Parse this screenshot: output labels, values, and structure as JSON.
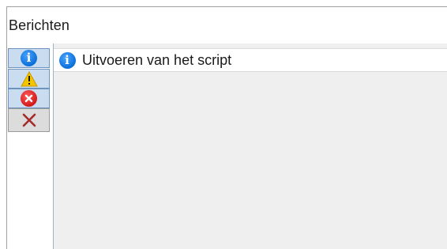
{
  "panel": {
    "title": "Berichten"
  },
  "toolbar": {
    "buttons": [
      {
        "name": "info-filter",
        "icon": "info-icon",
        "checked": true
      },
      {
        "name": "warning-filter",
        "icon": "warning-icon",
        "checked": true
      },
      {
        "name": "error-filter",
        "icon": "error-icon",
        "checked": true
      },
      {
        "name": "clear-messages",
        "icon": "clear-icon",
        "checked": false
      }
    ]
  },
  "messages": [
    {
      "icon": "info-icon",
      "text": "Uitvoeren van het script"
    }
  ],
  "colors": {
    "info": "#0a6fd8",
    "warning": "#f5c400",
    "error": "#d11a1a",
    "clear": "#a52a2a",
    "toggle_bg": "#c9dcf0"
  }
}
